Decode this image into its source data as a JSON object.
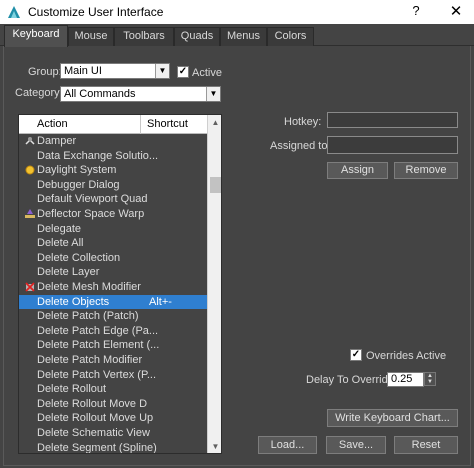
{
  "window": {
    "title": "Customize User Interface",
    "help_glyph": "?",
    "close_glyph": "✕"
  },
  "tabs": [
    {
      "label": "Keyboard",
      "active": true
    },
    {
      "label": "Mouse",
      "active": false
    },
    {
      "label": "Toolbars",
      "active": false
    },
    {
      "label": "Quads",
      "active": false
    },
    {
      "label": "Menus",
      "active": false
    },
    {
      "label": "Colors",
      "active": false
    }
  ],
  "group": {
    "label": "Group:",
    "value": "Main UI",
    "active_label": "Active",
    "active_checked": true
  },
  "category": {
    "label": "Category:",
    "value": "All Commands"
  },
  "action_list": {
    "columns": {
      "action": "Action",
      "shortcut": "Shortcut"
    },
    "rows": [
      {
        "action": "Damper",
        "shortcut": "",
        "icon": "damper-icon"
      },
      {
        "action": "Data Exchange Solutio...",
        "shortcut": "",
        "icon": ""
      },
      {
        "action": "Daylight System",
        "shortcut": "",
        "icon": "sun-icon"
      },
      {
        "action": "Debugger Dialog",
        "shortcut": "",
        "icon": ""
      },
      {
        "action": "Default Viewport Quad",
        "shortcut": "",
        "icon": ""
      },
      {
        "action": "Deflector Space Warp",
        "shortcut": "",
        "icon": "deflector-icon"
      },
      {
        "action": "Delegate",
        "shortcut": "",
        "icon": ""
      },
      {
        "action": "Delete All",
        "shortcut": "",
        "icon": ""
      },
      {
        "action": "Delete Collection",
        "shortcut": "",
        "icon": ""
      },
      {
        "action": "Delete Layer",
        "shortcut": "",
        "icon": ""
      },
      {
        "action": "Delete Mesh Modifier",
        "shortcut": "",
        "icon": "delete-mesh-icon"
      },
      {
        "action": "Delete Objects",
        "shortcut": "Alt+-",
        "icon": "",
        "selected": true
      },
      {
        "action": "Delete Patch (Patch)",
        "shortcut": "",
        "icon": ""
      },
      {
        "action": "Delete Patch Edge (Pa...",
        "shortcut": "",
        "icon": ""
      },
      {
        "action": "Delete Patch Element (...",
        "shortcut": "",
        "icon": ""
      },
      {
        "action": "Delete Patch Modifier",
        "shortcut": "",
        "icon": ""
      },
      {
        "action": "Delete Patch Vertex (P...",
        "shortcut": "",
        "icon": ""
      },
      {
        "action": "Delete Rollout",
        "shortcut": "",
        "icon": ""
      },
      {
        "action": "Delete Rollout Move D",
        "shortcut": "",
        "icon": ""
      },
      {
        "action": "Delete Rollout Move Up",
        "shortcut": "",
        "icon": ""
      },
      {
        "action": "Delete Schematic View",
        "shortcut": "",
        "icon": ""
      },
      {
        "action": "Delete Segment (Spline)",
        "shortcut": "",
        "icon": ""
      }
    ]
  },
  "hotkey": {
    "label": "Hotkey:",
    "value": ""
  },
  "assigned_to": {
    "label": "Assigned to:",
    "value": ""
  },
  "buttons": {
    "assign": "Assign",
    "remove": "Remove",
    "write_chart": "Write Keyboard Chart...",
    "load": "Load...",
    "save": "Save...",
    "reset": "Reset"
  },
  "overrides": {
    "label": "Overrides Active",
    "checked": true
  },
  "delay": {
    "label": "Delay To Override:",
    "value": "0.25"
  },
  "colors": {
    "selection": "#2f7fd0",
    "panel": "#444444",
    "title_bg": "#ffffff"
  }
}
